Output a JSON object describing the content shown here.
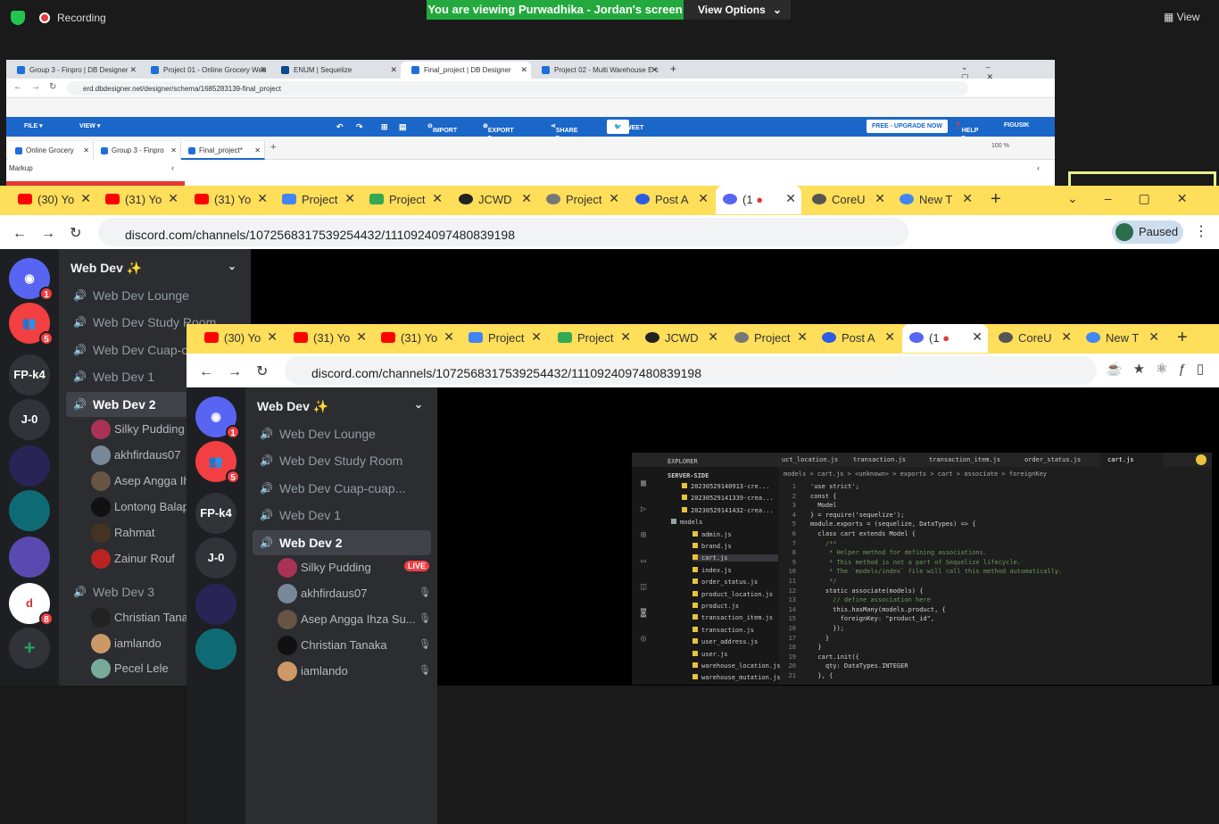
{
  "zoom": {
    "recording_label": "Recording",
    "viewing_banner": "You are viewing Purwadhika - Jordan's screen",
    "view_options": "View Options",
    "view_right": "View"
  },
  "dbbrowser": {
    "tabs": [
      "Group 3 - Finpro | DB Designer",
      "Project 01 - Online Grocery Web",
      "ENUM | Sequelize",
      "Final_project | DB Designer",
      "Project 02 - Multi Warehouse E-c"
    ],
    "url": "erd.dbdesigner.net/designer/schema/1685283139-final_project",
    "menu": [
      "FILE ▾",
      "VIEW ▾",
      "IMPORT",
      "EXPORT ▾",
      "SHARE ▾",
      "TWEET",
      "FREE - UPGRADE NOW",
      "HELP ▾",
      "FIGUSIK"
    ],
    "subtabs": [
      "Online Grocery",
      "Group 3 - Finpro",
      "Final_project*"
    ],
    "zoom": "100 %",
    "markup": "Markup"
  },
  "browser1": {
    "tabs": [
      "(30) Yo",
      "(31) Yo",
      "(31) Yo",
      "Project",
      "Project",
      "JCWD",
      "Project",
      "Post A",
      "(1",
      "CoreU",
      "New T"
    ],
    "url": "discord.com/channels/1072568317539254432/1110924097480839198",
    "paused": "Paused",
    "server_title": "Web Dev ✨",
    "servers": [
      "",
      "",
      "FP-k4",
      "J-0",
      "",
      "",
      "",
      ""
    ],
    "badges": [
      "1",
      "5",
      "8"
    ],
    "channels": [
      "Web Dev Lounge",
      "Web Dev Study Room",
      "Web Dev Cuap-cu",
      "Web Dev 1",
      "Web Dev 2"
    ],
    "users": [
      "Silky Pudding",
      "akhfirdaus07",
      "Asep Angga Ih",
      "Lontong Balap",
      "Rahmat",
      "Zainur Rouf"
    ],
    "channel3": "Web Dev 3",
    "users3": [
      "Christian Tana",
      "iamlando",
      "Pecel Lele"
    ]
  },
  "browser2": {
    "tabs": [
      "(30) Yo",
      "(31) Yo",
      "(31) Yo",
      "Project",
      "Project",
      "JCWD",
      "Project",
      "Post A",
      "(1",
      "CoreU",
      "New T"
    ],
    "url": "discord.com/channels/1072568317539254432/1110924097480839198",
    "server_title": "Web Dev ✨",
    "servers": [
      "",
      "",
      "FP-k4",
      "J-0",
      "",
      ""
    ],
    "channels": [
      "Web Dev Lounge",
      "Web Dev Study Room",
      "Web Dev Cuap-cuap...",
      "Web Dev 1",
      "Web Dev 2"
    ],
    "users": [
      "Silky Pudding",
      "akhfirdaus07",
      "Asep Angga Ihza Su...",
      "Christian Tanaka",
      "iamlando"
    ],
    "live": "LIVE"
  },
  "vscode": {
    "tabs": [
      "uct_location.js",
      "transaction.js",
      "transaction_item.js",
      "order_status.js",
      "cart.js"
    ],
    "explorer_title": "EXPLORER",
    "section": "SERVER-SIDE",
    "breadcrumb": "models > cart.js > <unknown> > exports > cart > associate > foreignKey",
    "files": [
      "20230529140913-cre...",
      "20230529141339-crea...",
      "20230529141432-crea...",
      "models",
      "admin.js",
      "brand.js",
      "cart.js",
      "index.js",
      "order_status.js",
      "product_location.js",
      "product.js",
      "transaction_item.js",
      "transaction.js",
      "user_address.js",
      "user.js",
      "warehouse_location.js",
      "warehouse_mutation.js"
    ],
    "code": [
      "'use strict';",
      "const {",
      "  Model",
      "} = require('sequelize');",
      "module.exports = (sequelize, DataTypes) => {",
      "  class cart extends Model {",
      "    /**",
      "     * Helper method for defining associations.",
      "     * This method is not a part of Sequelize lifecycle.",
      "     * The `models/index` file will call this method automatically.",
      "     */",
      "    static associate(models) {",
      "      // define association here",
      "      this.hasMany(models.product, {",
      "        foreignKey: \"product_id\",",
      "      });",
      "    }",
      "  }",
      "  cart.init({",
      "    qty: DataTypes.INTEGER",
      "  }, {"
    ]
  }
}
